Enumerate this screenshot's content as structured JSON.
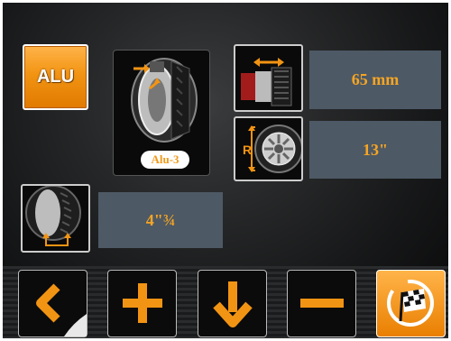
{
  "tire_type": {
    "label": "ALU"
  },
  "selection": {
    "label": "Alu-3"
  },
  "width": {
    "value": "65 mm"
  },
  "diameter": {
    "value": "13\""
  },
  "offset": {
    "value": "4\"¾"
  },
  "colors": {
    "accent": "#f29413",
    "value_text": "#f6a524",
    "value_bg": "#4d5965"
  },
  "toolbar": {
    "icons": [
      "back-icon",
      "plus-icon",
      "down-arrow-icon",
      "minus-icon",
      "finish-flag-icon"
    ]
  }
}
